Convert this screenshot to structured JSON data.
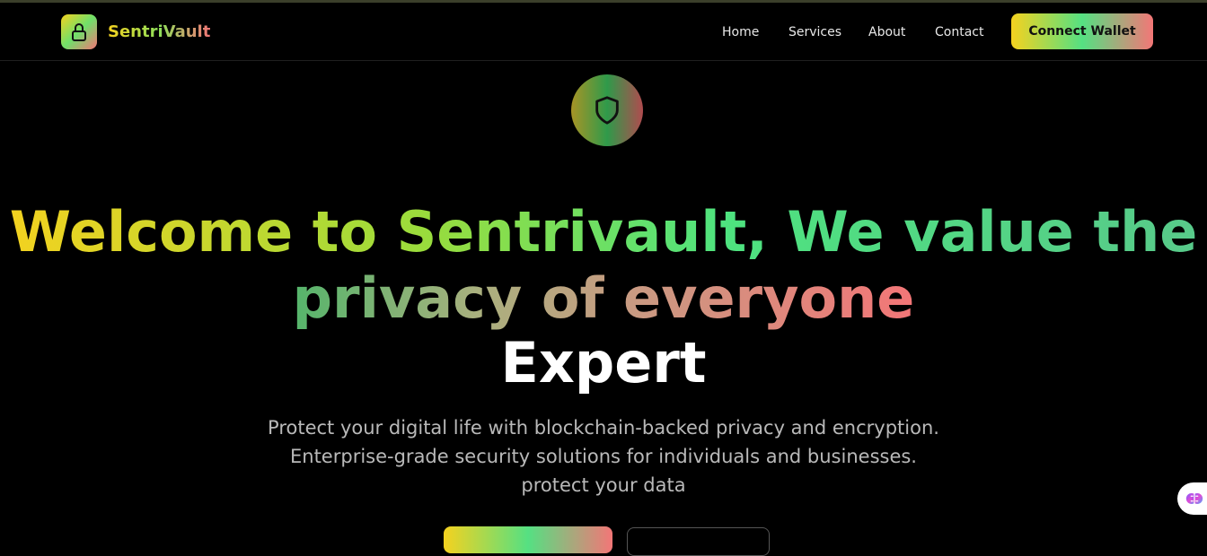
{
  "brand": {
    "name": "SentriVault",
    "logo_icon": "lock-icon"
  },
  "nav": {
    "links": [
      "Home",
      "Services",
      "About",
      "Contact"
    ],
    "cta_label": "Connect Wallet"
  },
  "hero": {
    "badge_icon": "shield-icon",
    "headline_line1": "Welcome to Sentrivault, We value the",
    "headline_line2": "privacy of everyone",
    "headline_line3": "Expert",
    "subtext": [
      "Protect your digital life with blockchain-backed privacy and encryption.",
      "Enterprise-grade security solutions for individuals and businesses.",
      "protect your data"
    ]
  },
  "colors": {
    "background": "#000000",
    "gradient_start": "#f5d21f",
    "gradient_mid": "#55e082",
    "gradient_end": "#f37677"
  }
}
